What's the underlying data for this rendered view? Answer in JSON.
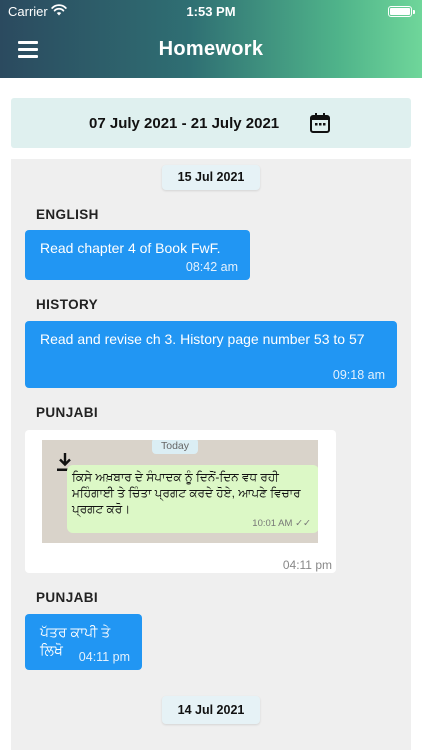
{
  "status_bar": {
    "carrier": "Carrier",
    "time": "1:53 PM"
  },
  "header": {
    "title": "Homework",
    "menu_icon": "hamburger-menu-icon"
  },
  "date_range": {
    "text": "07 July 2021 - 21 July 2021",
    "icon": "calendar-icon"
  },
  "feed": {
    "date_chips": [
      "15 Jul 2021",
      "14 Jul 2021"
    ],
    "entries": [
      {
        "subject": "ENGLISH",
        "message": "Read chapter 4 of Book FwF.",
        "time": "08:42 am"
      },
      {
        "subject": "HISTORY",
        "message": "Read and revise ch 3. History page number 53 to 57",
        "time": "09:18 am"
      },
      {
        "subject": "PUNJABI",
        "attachment": {
          "today_label": "Today",
          "text": "ਕਿਸੇ ਅਖ਼ਬਾਰ ਦੇ ਸੰਪਾਦਕ ਨੂੰ ਦਿਨੋਂ-ਦਿਨ ਵਧ ਰਹੀ ਮਹਿੰਗਾਈ ਤੇ ਚਿੰਤਾ ਪ੍ਰਗਟ ਕਰਦੇ ਹੋਏ, ਆਪਣੇ ਵਿਚਾਰ ਪ੍ਰਗਟ ਕਰੋ।",
          "inner_time": "10:01 AM ✓✓"
        },
        "time": "04:11 pm"
      },
      {
        "subject": "PUNJABI",
        "message": "ਪੱਤਰ ਕਾਪੀ ਤੇ ਲਿਖੋ",
        "time": "04:11 pm"
      }
    ]
  },
  "colors": {
    "bubble": "#2196f3",
    "feed_bg": "#efefef",
    "date_range_bg": "#dff0ef",
    "chip_bg": "#e6f2f6"
  }
}
